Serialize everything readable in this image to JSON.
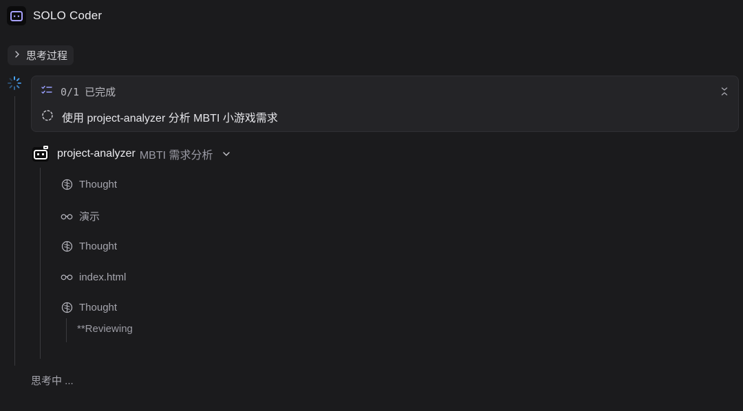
{
  "header": {
    "title": "SOLO Coder",
    "logo_icon": "terminal-box-icon"
  },
  "thinking_toggle": {
    "label": "思考过程"
  },
  "task_card": {
    "progress": "0/1",
    "status": "已完成",
    "item": "使用 project-analyzer 分析 MBTI 小游戏需求"
  },
  "agent": {
    "name": "project-analyzer",
    "description": "MBTI 需求分析"
  },
  "steps": [
    {
      "icon": "brain-icon",
      "label": "Thought"
    },
    {
      "icon": "glasses-icon",
      "label": "演示"
    },
    {
      "icon": "brain-icon",
      "label": "Thought"
    },
    {
      "icon": "glasses-icon",
      "label": "index.html"
    },
    {
      "icon": "brain-icon",
      "label": "Thought"
    }
  ],
  "sub_text": "**Reviewing",
  "footer_status": "思考中 ...",
  "colors": {
    "background": "#1b1b1d",
    "card": "#242427",
    "accent": "#7c83ff",
    "spinner": "#4aa8ff"
  }
}
